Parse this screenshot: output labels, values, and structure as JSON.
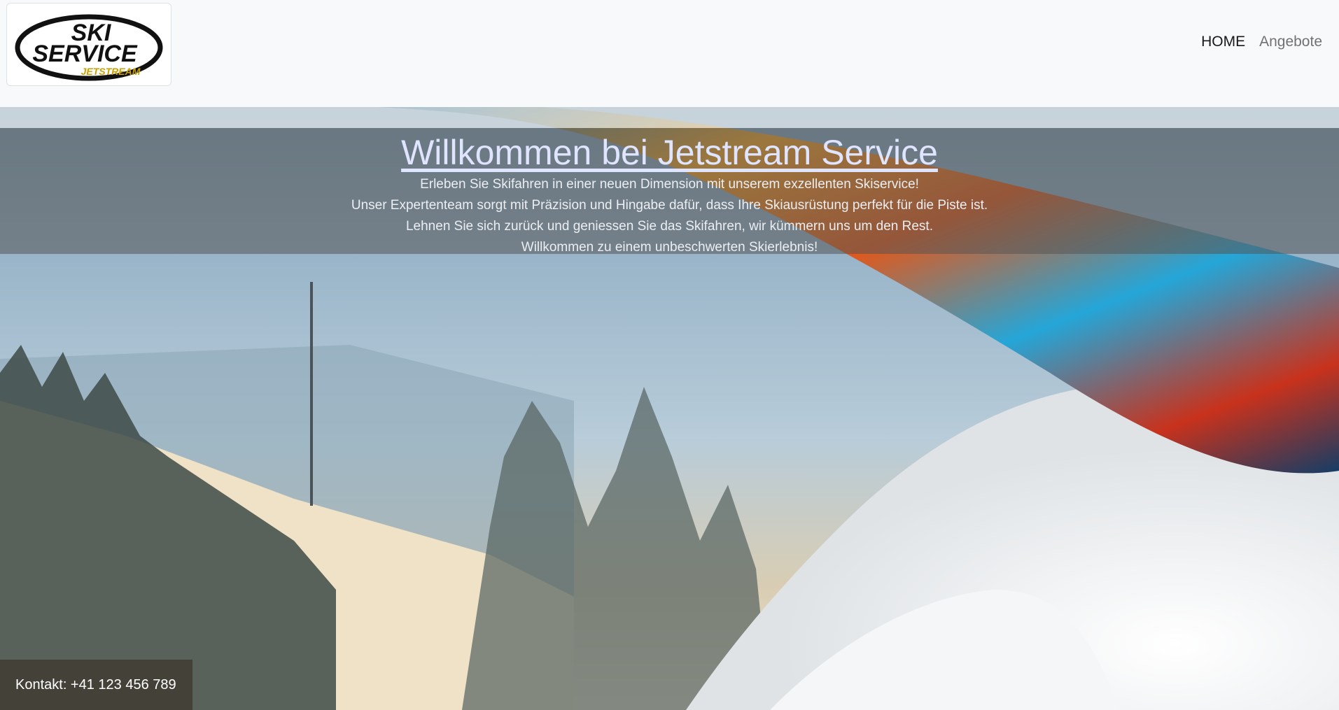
{
  "navbar": {
    "logo": {
      "text_top": "SKI",
      "text_main": "SERVICE",
      "text_sub": "JETSTREAM"
    },
    "links": [
      {
        "label": "HOME",
        "active": true
      },
      {
        "label": "Angebote",
        "active": false
      }
    ]
  },
  "hero": {
    "title": "Willkommen bei Jetstream Service",
    "lines": [
      "Erleben Sie Skifahren in einer neuen Dimension mit unserem exzellenten Skiservice!",
      "Unser Expertenteam sorgt mit Präzision und Hingabe dafür, dass Ihre Skiausrüstung perfekt für die Piste ist.",
      "Lehnen Sie sich zurück und geniessen Sie das Skifahren, wir kümmern uns um den Rest.",
      "Willkommen zu einem unbeschwerten Skierlebnis!"
    ]
  },
  "footer": {
    "contact": "Kontakt: +41 123 456 789"
  },
  "colors": {
    "navbar_bg": "#f8f9fa",
    "title_link": "#dfe4ff",
    "logo_accent": "#c9a100"
  }
}
